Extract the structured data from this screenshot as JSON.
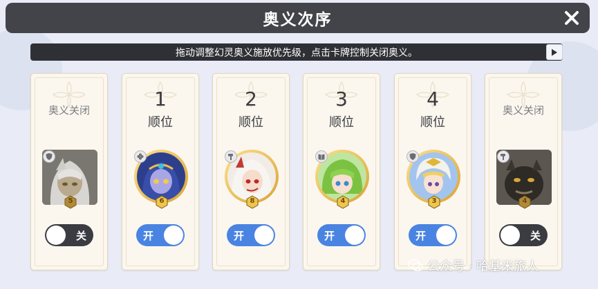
{
  "header": {
    "title": "奥义次序",
    "close_icon": "close-icon"
  },
  "hint": {
    "text": "拖动调整幻灵奥义施放优先级，点击卡牌控制关闭奥义。",
    "play_icon": "play-icon"
  },
  "cards": [
    {
      "rank_number": "",
      "rank_label": "",
      "closed_label": "奥义关闭",
      "state": "off",
      "toggle_label": "关",
      "level": "5",
      "type_icon": "shield-icon",
      "portrait": "white-haired-elf",
      "portrait_shape": "square"
    },
    {
      "rank_number": "1",
      "rank_label": "顺位",
      "closed_label": "",
      "state": "on",
      "toggle_label": "开",
      "level": "6",
      "type_icon": "flower-icon",
      "portrait": "blue-skinned-priestess",
      "portrait_shape": "round"
    },
    {
      "rank_number": "2",
      "rank_label": "顺位",
      "closed_label": "",
      "state": "on",
      "toggle_label": "开",
      "level": "8",
      "type_icon": "hammer-icon",
      "portrait": "white-haired-demon",
      "portrait_shape": "round"
    },
    {
      "rank_number": "3",
      "rank_label": "顺位",
      "closed_label": "",
      "state": "on",
      "toggle_label": "开",
      "level": "4",
      "type_icon": "book-icon",
      "portrait": "green-haired-boy",
      "portrait_shape": "round"
    },
    {
      "rank_number": "4",
      "rank_label": "顺位",
      "closed_label": "",
      "state": "on",
      "toggle_label": "开",
      "level": "3",
      "type_icon": "shield-icon",
      "portrait": "paladin-girl",
      "portrait_shape": "round"
    },
    {
      "rank_number": "",
      "rank_label": "",
      "closed_label": "奥义关闭",
      "state": "off",
      "toggle_label": "关",
      "level": "4",
      "type_icon": "hammer-icon",
      "portrait": "dark-beast",
      "portrait_shape": "square"
    }
  ],
  "watermark": {
    "text": "公众号 · 哈基米旅人",
    "icon": "wechat-icon"
  },
  "colors": {
    "header_bg": "#43444a",
    "toggle_on": "#4a84e2",
    "toggle_off": "#3b3c41",
    "card_bg": "#fbf7ef",
    "gold": "#e2b64a"
  }
}
